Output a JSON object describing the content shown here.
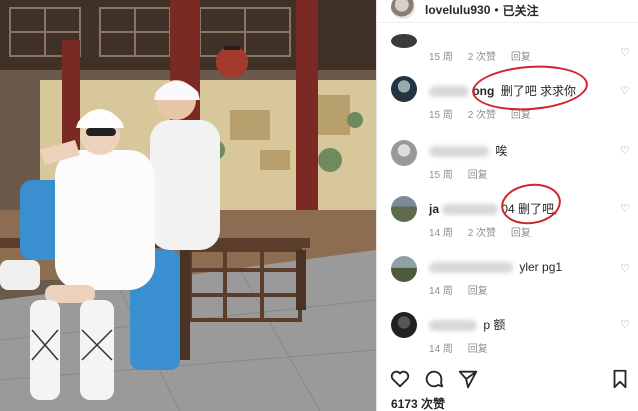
{
  "header": {
    "username": "lovelulu930",
    "separator": "•",
    "follow_label": "已关注"
  },
  "comments": [
    {
      "user": "",
      "text": "",
      "age": "15 周",
      "likes": "2 次赞",
      "reply": "回复"
    },
    {
      "user": "ong",
      "text": "删了吧 求求你",
      "age": "15 周",
      "likes": "2 次赞",
      "reply": "回复"
    },
    {
      "user": "",
      "text": "唉",
      "age": "15 周",
      "likes": "",
      "reply": "回复"
    },
    {
      "user": "ja",
      "text": "04 删了吧,",
      "age": "14 周",
      "likes": "2 次赞",
      "reply": "回复"
    },
    {
      "user": "",
      "text": "yler pg1",
      "age": "14 周",
      "likes": "",
      "reply": "回复"
    },
    {
      "user": "",
      "text": "p 额",
      "age": "14 周",
      "likes": "",
      "reply": "回复"
    }
  ],
  "actions": {
    "like_icon": "heart-icon",
    "comment_icon": "comment-icon",
    "share_icon": "paper-plane-icon",
    "save_icon": "bookmark-icon"
  },
  "likes_count": "6173 次赞",
  "colors": {
    "highlight": "#d2232a",
    "meta": "#8e8e8e",
    "text": "#262626"
  }
}
